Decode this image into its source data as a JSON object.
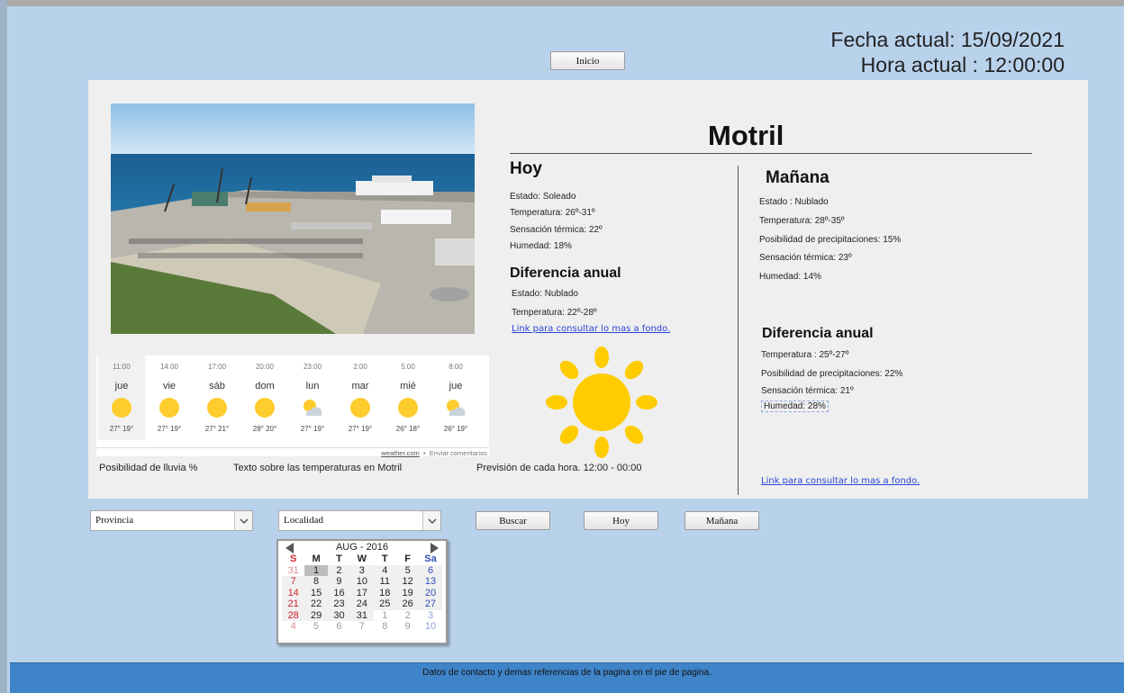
{
  "header": {
    "fecha_label": "Fecha actual: 15/09/2021",
    "hora_label": "Hora actual : 12:00:00",
    "inicio_button": "Inicio"
  },
  "city": "Motril",
  "widget": {
    "days": [
      {
        "time": "11:00",
        "day": "jue",
        "icon": "sun-icon",
        "temps": "27° 19°"
      },
      {
        "time": "14:00",
        "day": "vie",
        "icon": "sun-icon",
        "temps": "27° 19°"
      },
      {
        "time": "17:00",
        "day": "sáb",
        "icon": "sun-icon",
        "temps": "27° 21°"
      },
      {
        "time": "20:00",
        "day": "dom",
        "icon": "sun-icon",
        "temps": "28° 20°"
      },
      {
        "time": "23:00",
        "day": "lun",
        "icon": "partly-cloudy-icon",
        "temps": "27° 19°"
      },
      {
        "time": "2:00",
        "day": "mar",
        "icon": "sun-icon",
        "temps": "27° 19°"
      },
      {
        "time": "5:00",
        "day": "mié",
        "icon": "sun-icon",
        "temps": "26° 18°"
      },
      {
        "time": "8:00",
        "day": "jue",
        "icon": "partly-cloudy-icon",
        "temps": "26° 19°"
      }
    ],
    "source": "weather.com",
    "sep": "•",
    "feedback": "Enviar comentarios"
  },
  "captions": {
    "rain": "Posibilidad de lluvia %",
    "temps_text": "Texto sobre las temperaturas en Motril",
    "hourly": "Previsión de cada hora. 12:00 - 00:00"
  },
  "today": {
    "title": "Hoy",
    "estado": "Estado: Soleado",
    "temperatura": "Temperatura: 26º-31º",
    "sensacion": "Sensación térmica: 22º",
    "humedad": "Humedad: 18%",
    "annual_title": "Diferencia anual",
    "annual_estado": "Estado: Nublado",
    "annual_temperatura": "Temperatura: 22º-28º",
    "link": "Link para consultar lo mas a fondo."
  },
  "tomorrow": {
    "title": "Mañana",
    "estado": "Estado : Nublado",
    "temperatura": "Temperatura: 28º-35º",
    "precip": "Posibilidad de precipitaciones: 15%",
    "sensacion": "Sensación térmica: 23º",
    "humedad": "Humedad: 14%",
    "annual_title": "Diferencia anual",
    "annual_temperatura": "Temperatura : 25º-27º",
    "annual_precip": "Posibilidad de precipitaciones: 22%",
    "annual_sensacion": "Sensación térmica: 21º",
    "annual_humedad": "Humedad: 28%",
    "link": "Link para consultar lo mas a fondo."
  },
  "controls": {
    "provincia": "Provincia",
    "localidad": "Localidad",
    "buscar": "Buscar",
    "hoy": "Hoy",
    "manana": "Mañana"
  },
  "calendar": {
    "title": "AUG - 2016",
    "weekdays": [
      "S",
      "M",
      "T",
      "W",
      "T",
      "F",
      "Sa"
    ],
    "weeks": [
      [
        "31",
        "1",
        "2",
        "3",
        "4",
        "5",
        "6"
      ],
      [
        "7",
        "8",
        "9",
        "10",
        "11",
        "12",
        "13"
      ],
      [
        "14",
        "15",
        "16",
        "17",
        "18",
        "19",
        "20"
      ],
      [
        "21",
        "22",
        "23",
        "24",
        "25",
        "26",
        "27"
      ],
      [
        "28",
        "29",
        "30",
        "31",
        "1",
        "2",
        "3"
      ],
      [
        "4",
        "5",
        "6",
        "7",
        "8",
        "9",
        "10"
      ]
    ],
    "highlighted": "1"
  },
  "footer": "Datos de contacto y demas referencias de la pagina en el pie de pagina.",
  "colors": {
    "page_bg": "#b9d2ec",
    "footer_bg": "#3f84c8",
    "sun": "#ffcc00",
    "link": "#2b45d8"
  }
}
